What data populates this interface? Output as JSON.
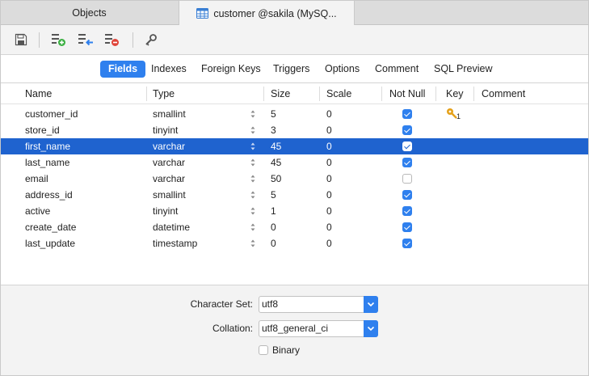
{
  "tabs": {
    "objects": "Objects",
    "active": "customer @sakila (MySQ..."
  },
  "toolbar": {
    "icons": [
      "save-icon",
      "add-field-icon",
      "insert-field-icon",
      "delete-field-icon",
      "key-icon"
    ]
  },
  "subtabs": [
    "Fields",
    "Indexes",
    "Foreign Keys",
    "Triggers",
    "Options",
    "Comment",
    "SQL Preview"
  ],
  "selected_subtab": "Fields",
  "grid": {
    "headers": {
      "name": "Name",
      "type": "Type",
      "size": "Size",
      "scale": "Scale",
      "notnull": "Not Null",
      "key": "Key",
      "comment": "Comment"
    },
    "rows": [
      {
        "name": "customer_id",
        "type": "smallint",
        "size": "5",
        "scale": "0",
        "notnull": true,
        "key": "1"
      },
      {
        "name": "store_id",
        "type": "tinyint",
        "size": "3",
        "scale": "0",
        "notnull": true,
        "key": ""
      },
      {
        "name": "first_name",
        "type": "varchar",
        "size": "45",
        "scale": "0",
        "notnull": true,
        "key": ""
      },
      {
        "name": "last_name",
        "type": "varchar",
        "size": "45",
        "scale": "0",
        "notnull": true,
        "key": ""
      },
      {
        "name": "email",
        "type": "varchar",
        "size": "50",
        "scale": "0",
        "notnull": false,
        "key": ""
      },
      {
        "name": "address_id",
        "type": "smallint",
        "size": "5",
        "scale": "0",
        "notnull": true,
        "key": ""
      },
      {
        "name": "active",
        "type": "tinyint",
        "size": "1",
        "scale": "0",
        "notnull": true,
        "key": ""
      },
      {
        "name": "create_date",
        "type": "datetime",
        "size": "0",
        "scale": "0",
        "notnull": true,
        "key": ""
      },
      {
        "name": "last_update",
        "type": "timestamp",
        "size": "0",
        "scale": "0",
        "notnull": true,
        "key": ""
      }
    ],
    "selected_row": 2
  },
  "properties": {
    "charset_label": "Character Set:",
    "charset_value": "utf8",
    "collation_label": "Collation:",
    "collation_value": "utf8_general_ci",
    "binary_label": "Binary",
    "binary_checked": false
  },
  "colors": {
    "accent": "#2f80ee",
    "selection": "#1f63cf",
    "key": "#e5a11a"
  }
}
